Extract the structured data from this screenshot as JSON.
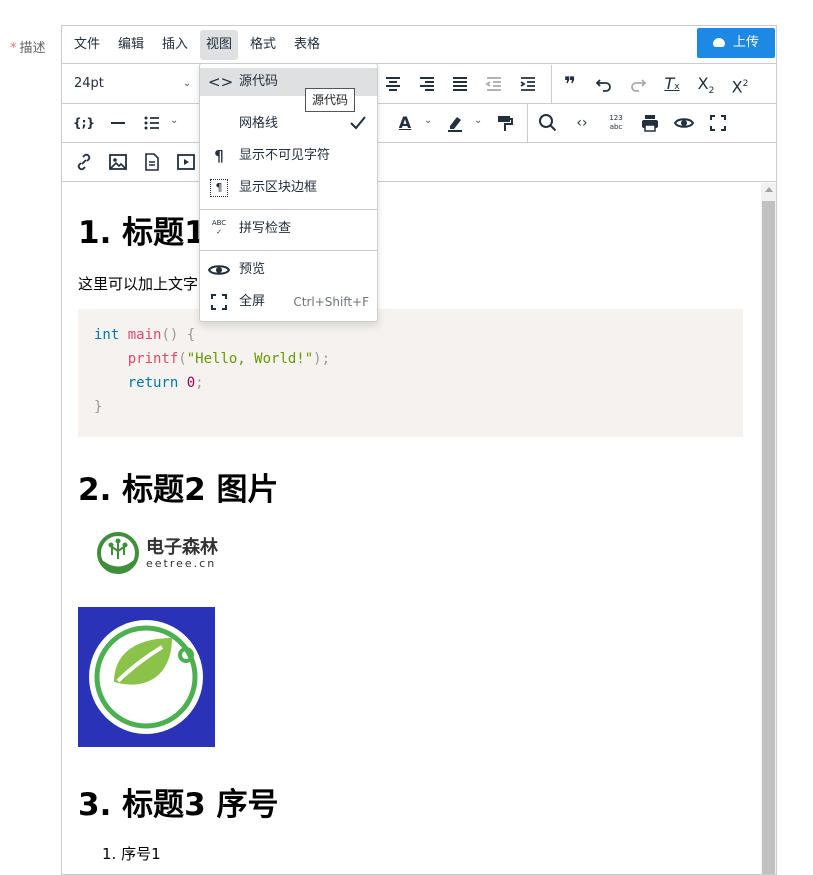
{
  "field": {
    "required_mark": "*",
    "label": "描述"
  },
  "menubar": {
    "items": [
      "文件",
      "编辑",
      "插入",
      "视图",
      "格式",
      "表格"
    ],
    "active_index": 3,
    "upload_label": "上传",
    "upload_icon": "cloud-upload-icon",
    "accent_color": "#1e88e5"
  },
  "toolbar": {
    "font_size": "24pt",
    "buttons_row1": [
      "align-center-icon",
      "align-right-icon",
      "align-justify-icon",
      "outdent-icon",
      "indent-icon",
      "blockquote-icon",
      "undo-icon",
      "redo-icon",
      "remove-format-icon",
      "subscript-icon",
      "superscript-icon"
    ],
    "buttons_row2": [
      "code-sample-icon",
      "horizontal-rule-icon",
      "bullet-list-icon",
      "font-color-icon",
      "highlight-color-icon",
      "format-painter-icon",
      "search-icon",
      "source-code-icon",
      "word-count-icon",
      "print-icon",
      "preview-icon",
      "fullscreen-icon"
    ],
    "buttons_row3": [
      "link-icon",
      "image-icon",
      "document-import-icon",
      "media-icon"
    ],
    "word_count_badge": "123 abc",
    "font_color_letter": "A",
    "sup_letter": "2",
    "sub_letter": "2",
    "x_letter": "X",
    "tx_letter": "T"
  },
  "view_menu": {
    "items": [
      {
        "label": "源代码",
        "icon": "source-code-icon",
        "glyph": "<>",
        "shortcut": ""
      },
      {
        "label": "网格线",
        "icon": "",
        "glyph": "",
        "shortcut": "",
        "checked": true
      },
      {
        "label": "显示不可见字符",
        "icon": "pilcrow-icon",
        "glyph": "¶",
        "shortcut": ""
      },
      {
        "label": "显示区块边框",
        "icon": "block-border-icon",
        "glyph": "¶",
        "shortcut": ""
      },
      {
        "label": "拼写检查",
        "icon": "spellcheck-icon",
        "glyph": "ABC",
        "shortcut": ""
      },
      {
        "label": "预览",
        "icon": "preview-icon",
        "glyph": "",
        "shortcut": ""
      },
      {
        "label": "全屏",
        "icon": "fullscreen-icon",
        "glyph": "",
        "shortcut": "Ctrl+Shift+F"
      }
    ],
    "tooltip": "源代码"
  },
  "content": {
    "heading1": "1. 标题1",
    "paragraph": "这里可以加上文字",
    "code": {
      "line1": {
        "kw": "int",
        "fn": "main",
        "pun": "() {"
      },
      "line2": {
        "fn": "printf",
        "open": "(",
        "str": "\"Hello, World!\"",
        "close": ");"
      },
      "line3": {
        "kw": "return",
        "num": "0",
        "pun": ";"
      },
      "line4": "}"
    },
    "heading2": "2. 标题2 图片",
    "logo_text_cn": "电子森林",
    "logo_text_en": "eetree.cn",
    "heading3": "3. 标题3 序号",
    "list_item": "1. 序号1"
  }
}
